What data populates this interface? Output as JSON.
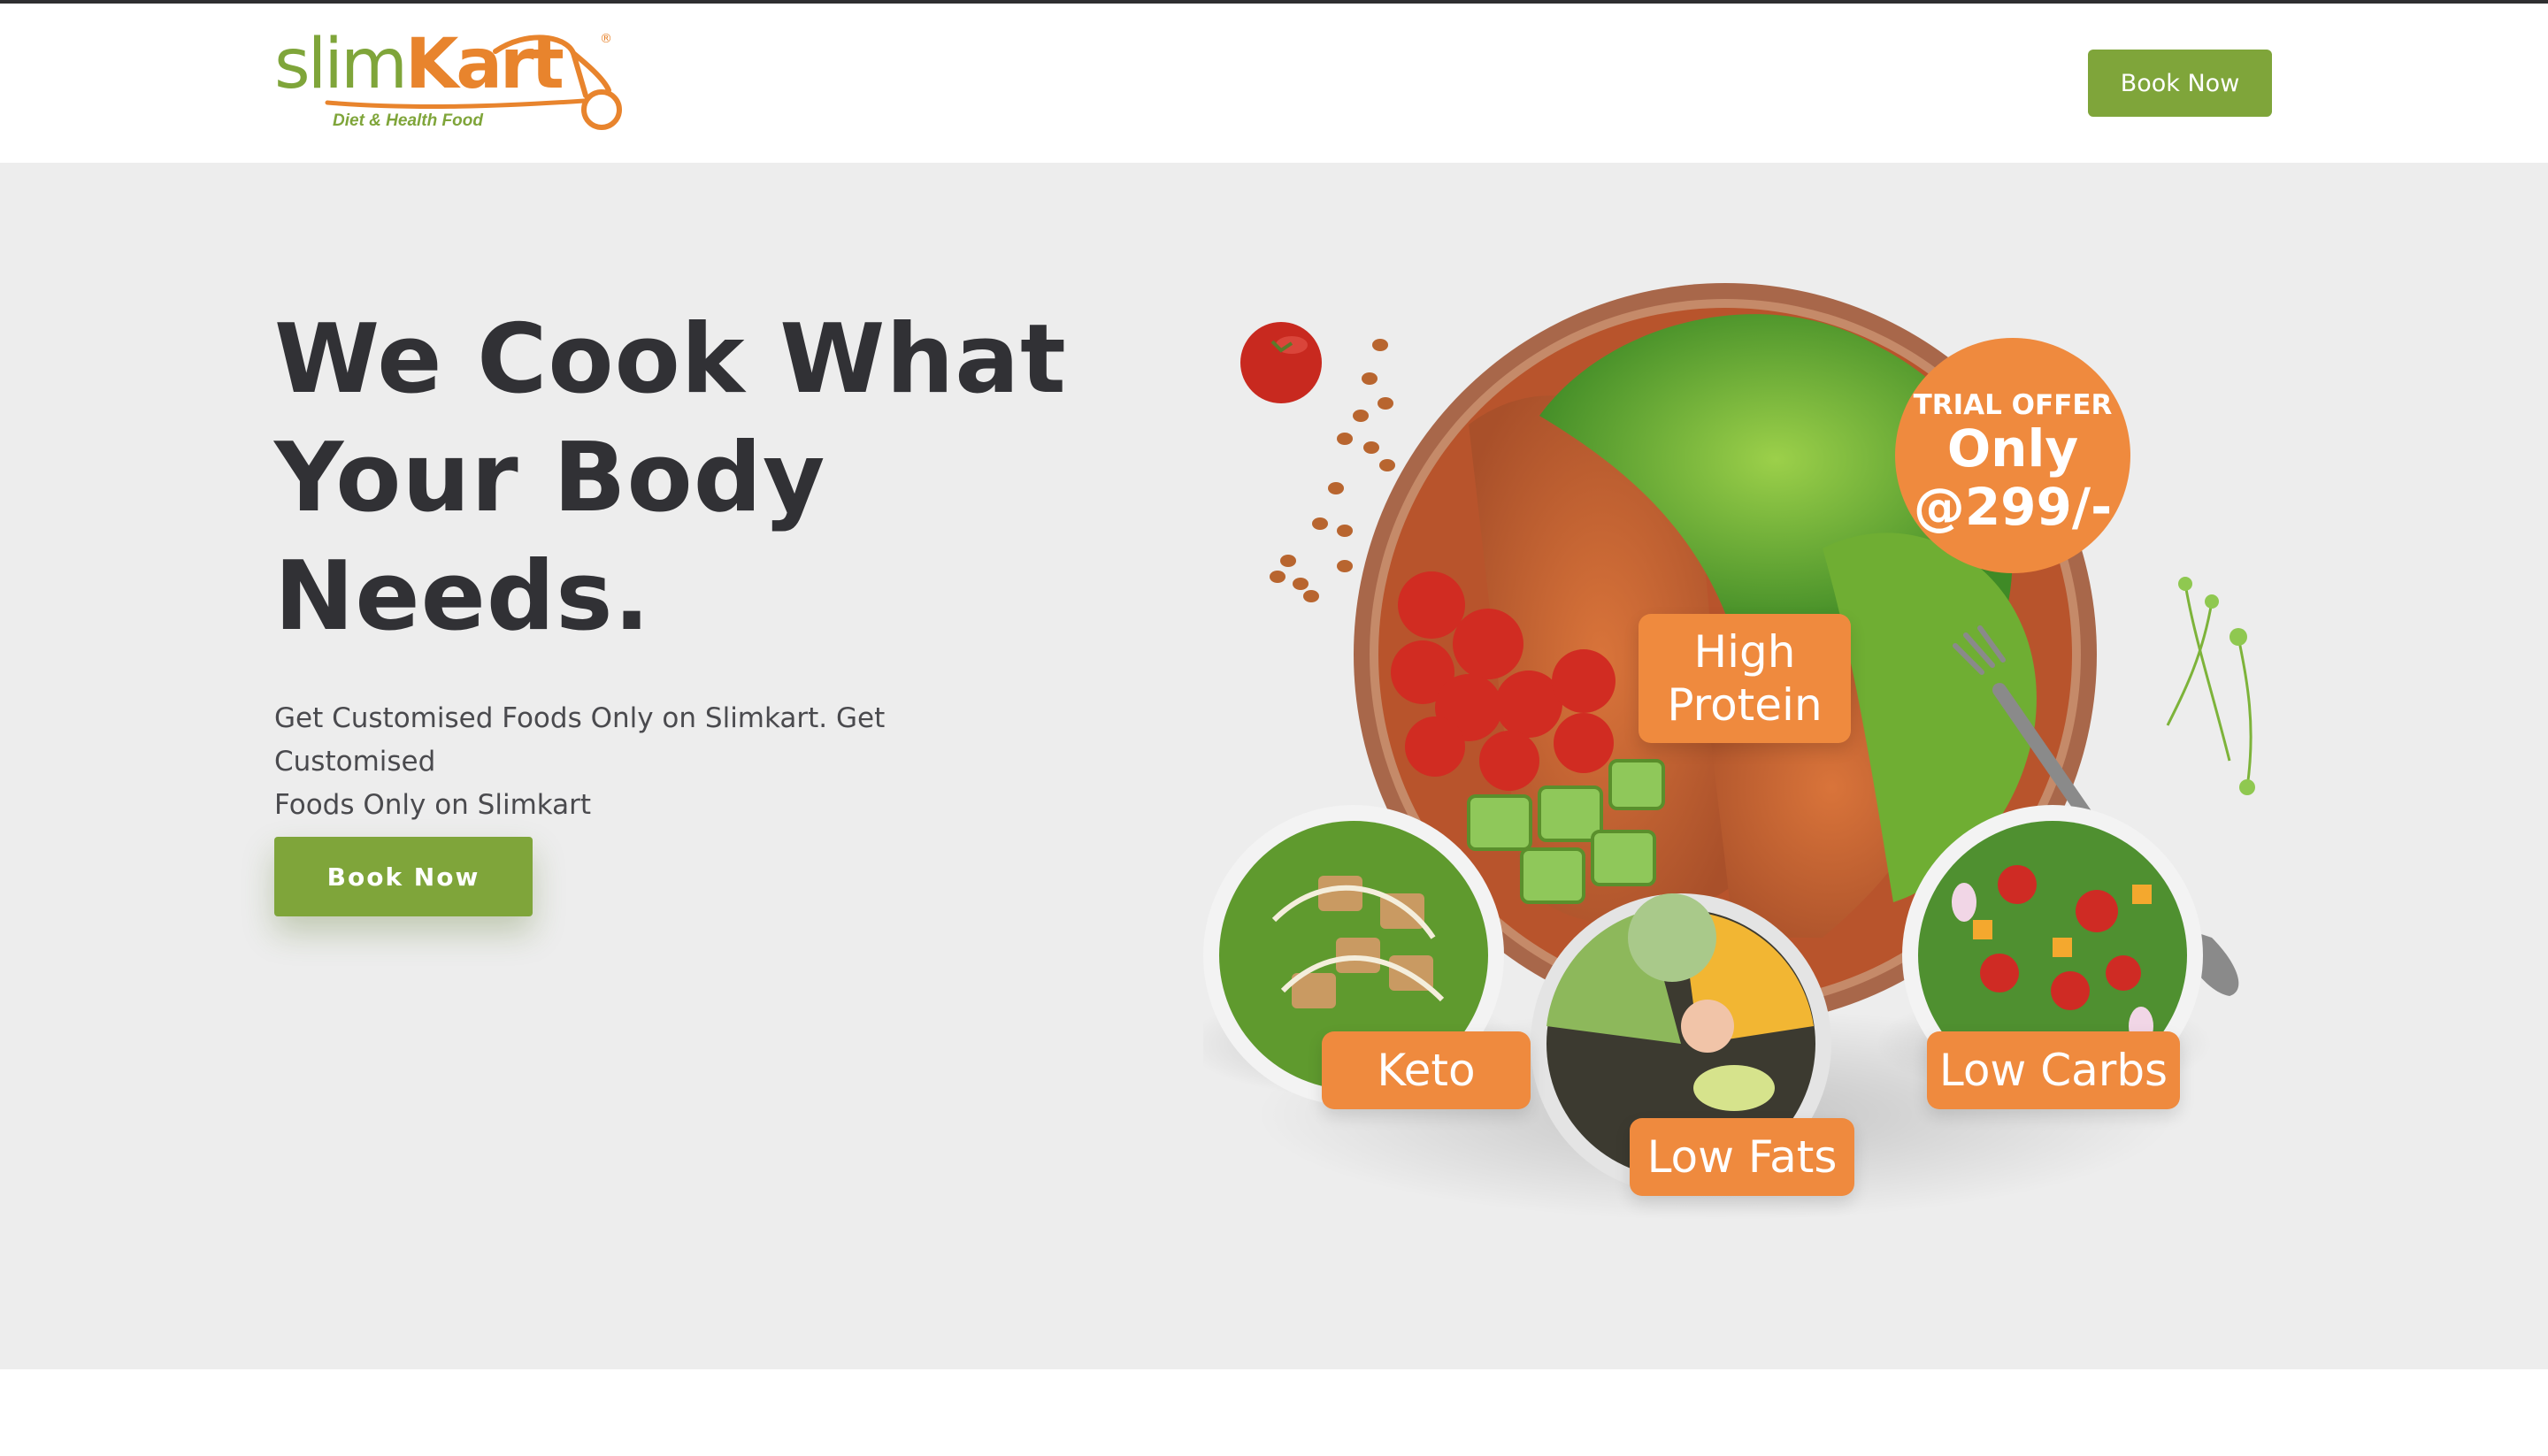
{
  "header": {
    "logo": {
      "brand_part1": "slim",
      "brand_part2": "Kart",
      "registered": "®",
      "tagline": "Diet & Health Food"
    },
    "book_button": "Book Now"
  },
  "hero": {
    "headline_lines": [
      "We Cook What",
      "Your Body",
      "Needs."
    ],
    "subtext_lines": [
      "Get Customised Foods Only on Slimkart. Get Customised",
      "Foods Only on Slimkart"
    ],
    "cta_button": "Book Now"
  },
  "food_image": {
    "offer": {
      "line1": "TRIAL OFFER",
      "line2": "Only",
      "line3": "@299/-"
    },
    "tags": {
      "high_protein": [
        "High",
        "Protein"
      ],
      "keto": "Keto",
      "low_carbs": "Low Carbs",
      "low_fats": "Low Fats"
    }
  },
  "colors": {
    "brand_green": "#7fa53a",
    "brand_orange": "#e8842d",
    "tag_orange": "#ef8a3e",
    "hero_background": "#ededed",
    "heading_text": "#313135"
  }
}
